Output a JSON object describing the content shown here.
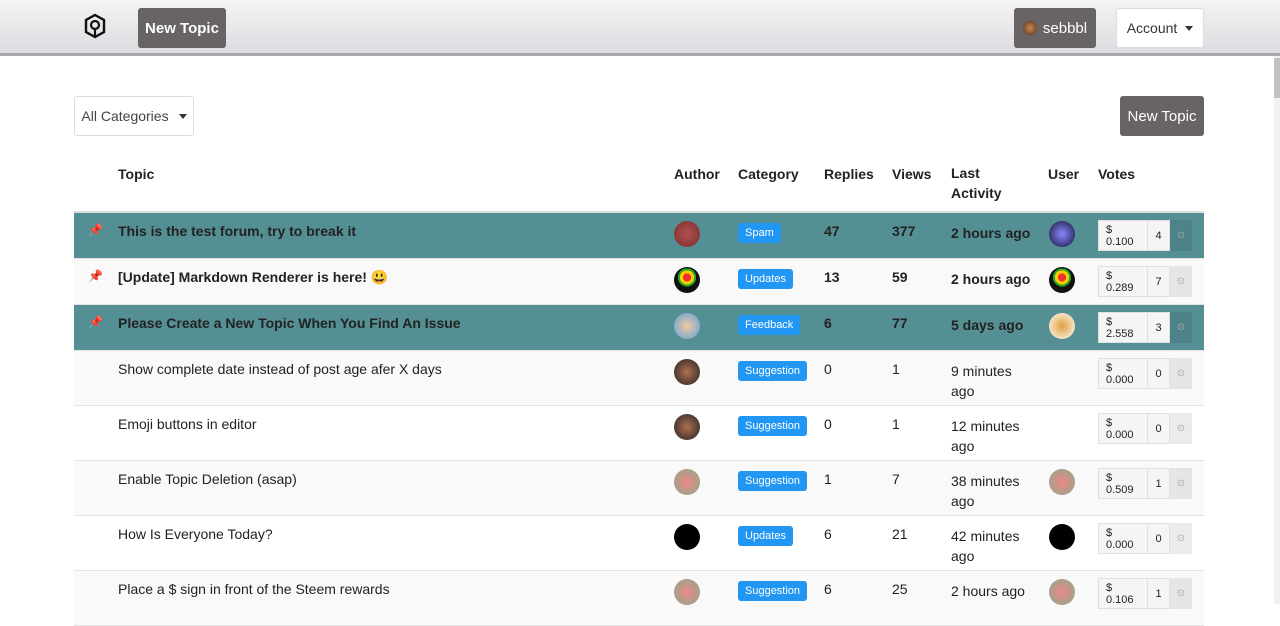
{
  "nav": {
    "new_topic": "New Topic",
    "username": "sebbbl",
    "account": "Account"
  },
  "toolbar": {
    "categories": "All Categories",
    "new_topic": "New Topic"
  },
  "columns": {
    "topic": "Topic",
    "author": "Author",
    "category": "Category",
    "replies": "Replies",
    "views": "Views",
    "last_activity": "Last Activity",
    "user": "User",
    "votes": "Votes"
  },
  "colors": {
    "pinned_row": "#548f94",
    "badge": "#2196f3",
    "button": "#686364"
  },
  "topics": [
    {
      "title": "This is the test forum, try to break it",
      "category": "Spam",
      "replies": "47",
      "views": "377",
      "last": "2 hours ago",
      "payout": "$ 0.100",
      "votes": "4"
    },
    {
      "title": "[Update] Markdown Renderer is here! 😃",
      "category": "Updates",
      "replies": "13",
      "views": "59",
      "last": "2 hours ago",
      "payout": "$ 0.289",
      "votes": "7"
    },
    {
      "title": "Please Create a New Topic When You Find An Issue",
      "category": "Feedback",
      "replies": "6",
      "views": "77",
      "last": "5 days ago",
      "payout": "$ 2.558",
      "votes": "3"
    },
    {
      "title": "Show complete date instead of post age afer X days",
      "category": "Suggestion",
      "replies": "0",
      "views": "1",
      "last": "9 minutes ago",
      "payout": "$ 0.000",
      "votes": "0"
    },
    {
      "title": "Emoji buttons in editor",
      "category": "Suggestion",
      "replies": "0",
      "views": "1",
      "last": "12 minutes ago",
      "payout": "$ 0.000",
      "votes": "0"
    },
    {
      "title": "Enable Topic Deletion (asap)",
      "category": "Suggestion",
      "replies": "1",
      "views": "7",
      "last": "38 minutes ago",
      "payout": "$ 0.509",
      "votes": "1"
    },
    {
      "title": "How Is Everyone Today?",
      "category": "Updates",
      "replies": "6",
      "views": "21",
      "last": "42 minutes ago",
      "payout": "$ 0.000",
      "votes": "0"
    },
    {
      "title": "Place a $ sign in front of the Steem rewards",
      "category": "Suggestion",
      "replies": "6",
      "views": "25",
      "last": "2 hours ago",
      "payout": "$ 0.106",
      "votes": "1"
    }
  ]
}
